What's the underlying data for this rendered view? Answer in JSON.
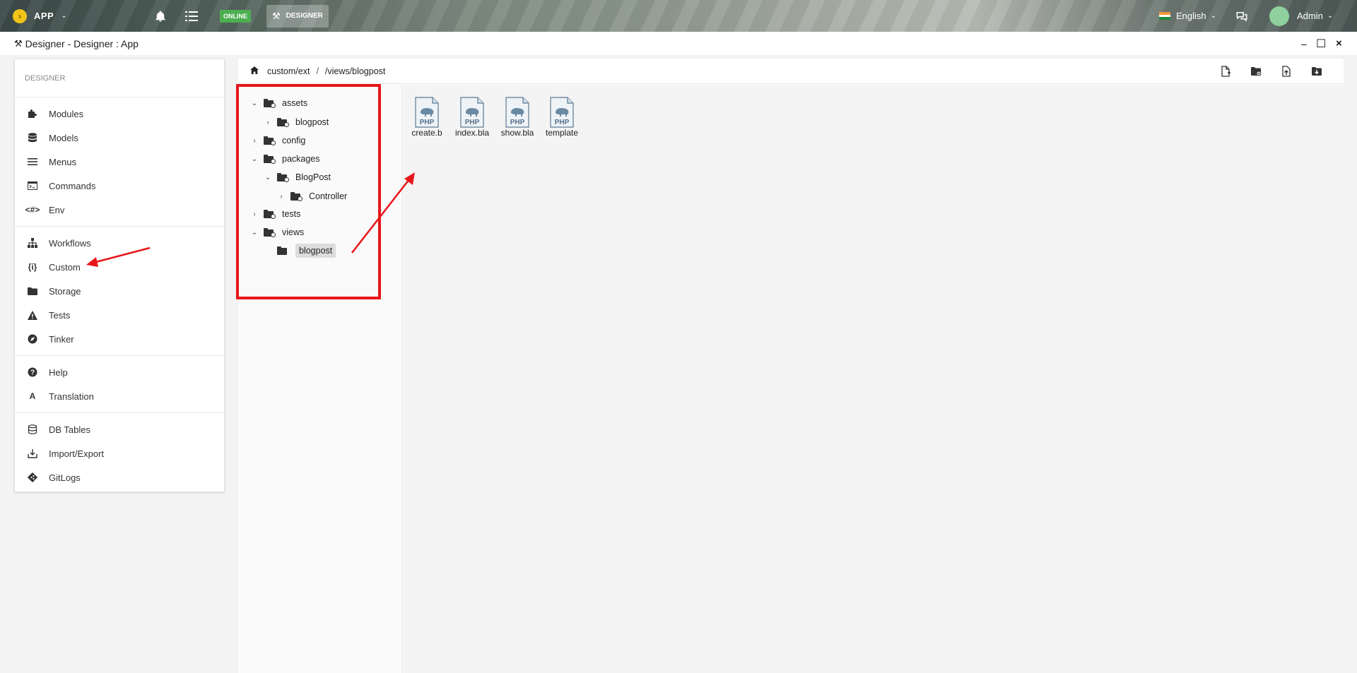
{
  "topbar": {
    "app_name": "APP",
    "status": "ONLINE",
    "designer_label": "DESIGNER",
    "language": "English",
    "user": "Admin",
    "icons": [
      "chevron-right-icon",
      "bell-icon",
      "list-icon",
      "hammer-icon",
      "chat-icon",
      "flag-icon",
      "avatar"
    ]
  },
  "window": {
    "title": "Designer - Designer : App",
    "controls": [
      "–",
      "☐",
      "×"
    ]
  },
  "sidebar": {
    "header": "DESIGNER",
    "groups": [
      [
        {
          "label": "Modules",
          "icon": "puzzle-icon"
        },
        {
          "label": "Models",
          "icon": "database-icon"
        },
        {
          "label": "Menus",
          "icon": "menu-icon"
        },
        {
          "label": "Commands",
          "icon": "terminal-icon"
        },
        {
          "label": "Env",
          "icon": "code-icon"
        }
      ],
      [
        {
          "label": "Workflows",
          "icon": "sitemap-icon"
        },
        {
          "label": "Custom",
          "icon": "braces-icon"
        },
        {
          "label": "Storage",
          "icon": "folder-icon"
        },
        {
          "label": "Tests",
          "icon": "warning-icon"
        },
        {
          "label": "Tinker",
          "icon": "compass-icon"
        }
      ],
      [
        {
          "label": "Help",
          "icon": "help-icon"
        },
        {
          "label": "Translation",
          "icon": "translate-icon"
        }
      ],
      [
        {
          "label": "DB Tables",
          "icon": "database-icon"
        },
        {
          "label": "Import/Export",
          "icon": "import-icon"
        },
        {
          "label": "GitLogs",
          "icon": "git-icon"
        }
      ]
    ]
  },
  "breadcrumb": {
    "root": "custom/ext",
    "separator": "/",
    "path": "/views/blogpost"
  },
  "toolbar": [
    "new-file-icon",
    "new-folder-icon",
    "upload-icon",
    "download-icon"
  ],
  "tree": [
    {
      "label": "assets",
      "toggle": "⌄"
    },
    {
      "label": "blogpost",
      "toggle": "›"
    },
    {
      "label": "config",
      "toggle": "›"
    },
    {
      "label": "packages",
      "toggle": "⌄"
    },
    {
      "label": "BlogPost",
      "toggle": "⌄"
    },
    {
      "label": "Controller",
      "toggle": "›"
    },
    {
      "label": "tests",
      "toggle": "›"
    },
    {
      "label": "views",
      "toggle": "⌄"
    },
    {
      "label": "blogpost",
      "toggle": ""
    }
  ],
  "files": [
    {
      "name": "create.b",
      "type": "PHP"
    },
    {
      "name": "index.bla",
      "type": "PHP"
    },
    {
      "name": "show.bla",
      "type": "PHP"
    },
    {
      "name": "template",
      "type": "PHP"
    }
  ],
  "colors": {
    "annotation": "#e8161b",
    "online": "#4caf50",
    "logo": "#f0c419"
  }
}
